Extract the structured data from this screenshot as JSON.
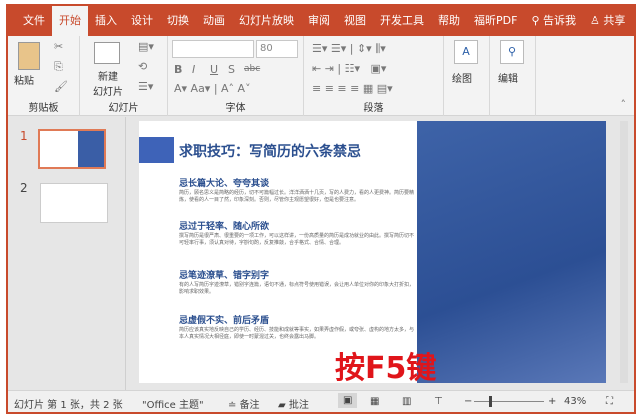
{
  "tabs": [
    "文件",
    "开始",
    "插入",
    "设计",
    "切换",
    "动画",
    "幻灯片放映",
    "审阅",
    "视图",
    "开发工具",
    "帮助",
    "福昕PDF"
  ],
  "tell_me": "告诉我",
  "share": "共享",
  "ribbon": {
    "paste": "粘贴",
    "clipboard": "剪贴板",
    "new_slide_1": "新建",
    "new_slide_2": "幻灯片",
    "slides": "幻灯片",
    "font_size": "80",
    "font": "字体",
    "paragraph": "段落",
    "draw": "绘图",
    "edit": "编辑",
    "bold": "B",
    "italic": "I",
    "underline": "U",
    "shadow": "S",
    "strike": "abc"
  },
  "thumbnails": [
    "1",
    "2"
  ],
  "slide": {
    "title": "求职技巧：写简历的六条禁忌",
    "sections": [
      {
        "heading": "忌长篇大论、夸夸其谈",
        "body": "简历，顾名思义是简略的经历，切不可篇幅过长。洋洋洒洒十几页，写的人费力，看的人更费神。简历要精炼，使看的人一目了然，印象深刻。否则，尽管你主观愿望很好，但是也要注意。"
      },
      {
        "heading": "忌过于轻率、随心所欲",
        "body": "撰写简历是很严肃、很重要的一项工作，可以这样讲，一份高质量的简历是成功就业的由此。撰写简历切不可轻率行事，须认真对待，字斟句酌，反复推敲，合乎格式、合情、合理。"
      },
      {
        "heading": "忌笔迹潦草、错字别字",
        "body": "有的人写简历字迹潦草，错别字连篇，语句不通，标点符号使用错误，会让用人单位对你的印象大打折扣，影响求职效果。"
      },
      {
        "heading": "忌虚假不实、前后矛盾",
        "body": "简历应该真实地反映自己的学历、经历、技能和成就等事实，如果弄虚作假，或夸张、虚构的地方太多，与本人真实情况大相径庭，即使一时蒙混过关，也终会露出马脚。"
      }
    ],
    "overlay": "按F5键"
  },
  "status": {
    "slide_info": "幻灯片 第 1 张，共 2 张",
    "theme": "\"Office 主题\"",
    "notes": "备注",
    "comments": "批注",
    "zoom": "43%",
    "zoom_fraction": 0.43
  },
  "colors": {
    "accent": "#c84a2c",
    "slide_blue": "#2b4f8f"
  }
}
